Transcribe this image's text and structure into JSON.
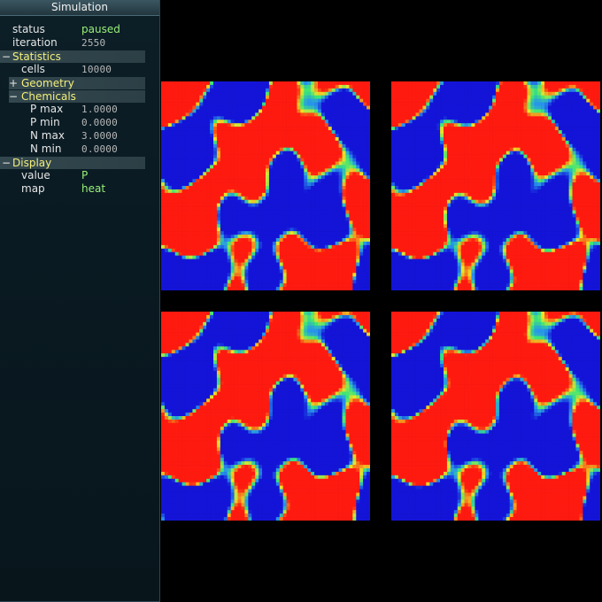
{
  "window": {
    "title": "Simulation"
  },
  "properties": {
    "status": {
      "label": "status",
      "value": "paused"
    },
    "iteration": {
      "label": "iteration",
      "value": "2550"
    }
  },
  "statistics": {
    "toggle": "−",
    "label": "Statistics",
    "cells": {
      "label": "cells",
      "value": "10000"
    },
    "geometry": {
      "toggle": "+",
      "label": "Geometry"
    },
    "chemicals": {
      "toggle": "−",
      "label": "Chemicals",
      "p_max": {
        "label": "P max",
        "value": "1.0000"
      },
      "p_min": {
        "label": "P min",
        "value": "0.0000"
      },
      "n_max": {
        "label": "N max",
        "value": "3.0000"
      },
      "n_min": {
        "label": "N min",
        "value": "0.0000"
      }
    }
  },
  "display": {
    "toggle": "−",
    "label": "Display",
    "value": {
      "label": "value",
      "value": "P"
    },
    "map": {
      "label": "map",
      "value": "heat"
    }
  },
  "colors": {
    "sidebar_bg": "#0a1a22",
    "group_label": "#f3ef7c",
    "string_value": "#98f07a",
    "heat_high": "#ff1a10",
    "heat_low": "#1414d8"
  },
  "views": [
    {
      "name": "top-left"
    },
    {
      "name": "top-right"
    },
    {
      "name": "bottom-left"
    },
    {
      "name": "bottom-right"
    }
  ]
}
